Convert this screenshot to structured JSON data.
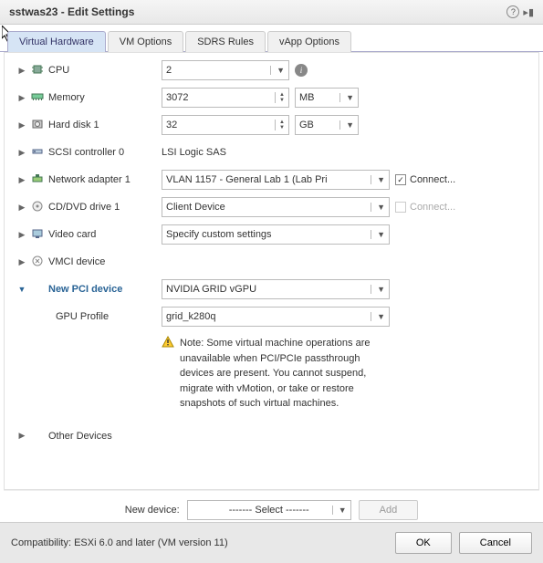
{
  "window": {
    "title": "sstwas23 - Edit Settings"
  },
  "tabs": [
    {
      "label": "Virtual Hardware",
      "active": true
    },
    {
      "label": "VM Options"
    },
    {
      "label": "SDRS Rules"
    },
    {
      "label": "vApp Options"
    }
  ],
  "rows": {
    "cpu": {
      "label": "CPU",
      "value": "2"
    },
    "memory": {
      "label": "Memory",
      "value": "3072",
      "unit": "MB"
    },
    "hdd": {
      "label": "Hard disk 1",
      "value": "32",
      "unit": "GB"
    },
    "scsi": {
      "label": "SCSI controller 0",
      "value": "LSI Logic SAS"
    },
    "net": {
      "label": "Network adapter 1",
      "value": "VLAN 1157 - General Lab 1 (Lab Pri",
      "connect": "Connect..."
    },
    "cd": {
      "label": "CD/DVD drive 1",
      "value": "Client Device",
      "connect": "Connect..."
    },
    "video": {
      "label": "Video card",
      "value": "Specify custom settings"
    },
    "vmci": {
      "label": "VMCI device"
    },
    "pci": {
      "label": "New PCI device",
      "value": "NVIDIA GRID vGPU"
    },
    "gpu": {
      "label": "GPU Profile",
      "value": "grid_k280q"
    },
    "note": "Note: Some virtual machine operations are unavailable when PCI/PCIe passthrough devices are present. You cannot suspend, migrate with vMotion, or take or restore snapshots of such virtual machines.",
    "other": {
      "label": "Other Devices"
    }
  },
  "newdevice": {
    "label": "New device:",
    "select": "------- Select -------",
    "add": "Add"
  },
  "footer": {
    "compat": "Compatibility: ESXi 6.0 and later (VM version 11)",
    "ok": "OK",
    "cancel": "Cancel"
  }
}
